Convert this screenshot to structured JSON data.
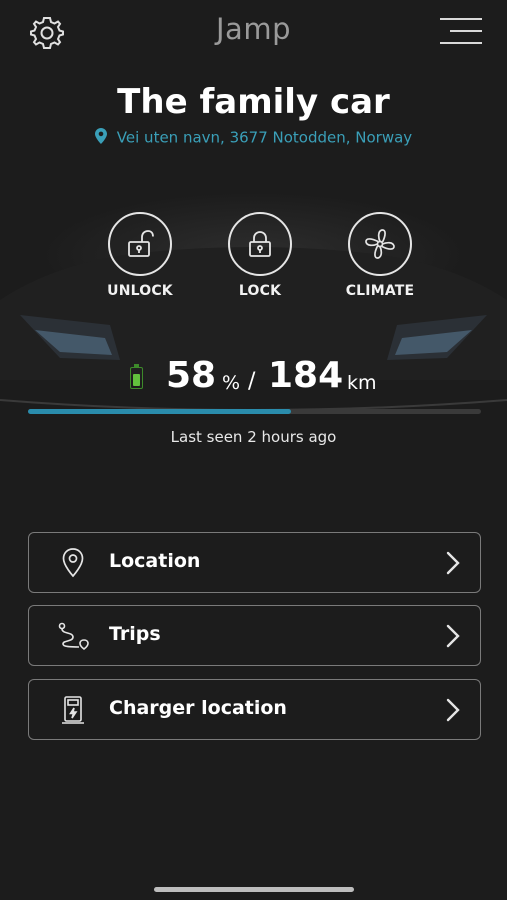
{
  "header": {
    "brand": "Jamp"
  },
  "car": {
    "name": "The family car",
    "address": "Vei uten navn, 3677 Notodden, Norway"
  },
  "actions": [
    {
      "label": "UNLOCK",
      "icon": "unlock-icon"
    },
    {
      "label": "LOCK",
      "icon": "lock-icon"
    },
    {
      "label": "CLIMATE",
      "icon": "fan-icon"
    }
  ],
  "status": {
    "battery_percent": "58",
    "battery_unit": "%",
    "separator": "/",
    "range": "184",
    "range_unit": "km",
    "last_seen": "Last seen 2 hours ago",
    "progress_fraction": 0.58
  },
  "menu": [
    {
      "label": "Location",
      "icon": "location-pin-icon"
    },
    {
      "label": "Trips",
      "icon": "route-icon"
    },
    {
      "label": "Charger location",
      "icon": "charger-icon"
    }
  ],
  "colors": {
    "background": "#1c1c1c",
    "accent": "#2a8cac",
    "address": "#3a9fb8",
    "battery": "#62c23d"
  }
}
